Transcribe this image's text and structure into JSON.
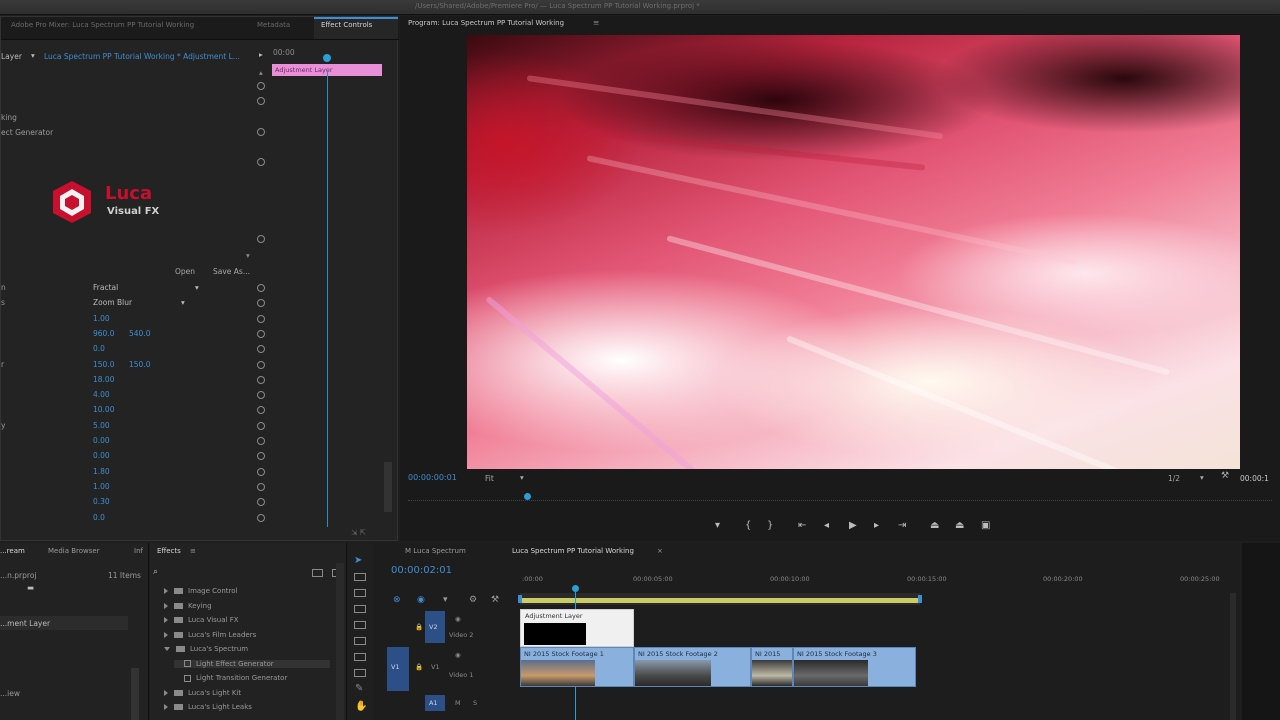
{
  "window": {
    "title": "/Users/Shared/Adobe/Premiere Pro/ — Luca Spectrum PP Tutorial Working.prproj *"
  },
  "effect_controls": {
    "tabs": [
      "Adobe Pro Mixer: Luca Spectrum PP Tutorial Working",
      "Metadata",
      "Effect Controls"
    ],
    "source_label": "Layer",
    "clip_path": "Luca Spectrum PP Tutorial Working * Adjustment L...",
    "time": "00:00",
    "clip_bar": "Adjustment Layer",
    "rows_left": [
      "king",
      "ect Generator"
    ],
    "logo": {
      "word": "Luca",
      "sub": "Visual FX"
    },
    "open_label": "Open",
    "save_label": "Save As...",
    "params": [
      {
        "label": "n",
        "value": "Fractal",
        "dropdown": true
      },
      {
        "label": "s",
        "value": "Zoom Blur",
        "dropdown": true
      },
      {
        "label": "",
        "value": "1.00"
      },
      {
        "label": "",
        "value": "960.0",
        "value2": "540.0"
      },
      {
        "label": "",
        "value": "0.0"
      },
      {
        "label": "r",
        "value": "150.0",
        "value2": "150.0"
      },
      {
        "label": "",
        "value": "18.00"
      },
      {
        "label": "",
        "value": "4.00"
      },
      {
        "label": "",
        "value": "10.00"
      },
      {
        "label": "y",
        "value": "5.00"
      },
      {
        "label": "",
        "value": "0.00"
      },
      {
        "label": "",
        "value": "0.00"
      },
      {
        "label": "",
        "value": "1.80"
      },
      {
        "label": "",
        "value": "1.00"
      },
      {
        "label": "",
        "value": "0.30"
      },
      {
        "label": "",
        "value": "0.0"
      }
    ]
  },
  "program_monitor": {
    "title": "Program: Luca Spectrum PP Tutorial Working",
    "timecode": "00:00:00:01",
    "fit": "Fit",
    "resolution": "1/2",
    "end_timecode": "00:00:1"
  },
  "project_panel": {
    "tabs": [
      "...ream",
      "Media Browser",
      "Inf"
    ],
    "path": "...n.prproj",
    "items_count": "11 Items",
    "item": "...ment Layer",
    "item2": "...iew"
  },
  "effects_panel": {
    "title": "Effects",
    "folders": [
      {
        "name": "Image Control",
        "open": false,
        "indent": 0
      },
      {
        "name": "Keying",
        "open": false,
        "indent": 0
      },
      {
        "name": "Luca Visual FX",
        "open": false,
        "indent": 0
      },
      {
        "name": "Luca's Film Leaders",
        "open": false,
        "indent": 0
      },
      {
        "name": "Luca's Spectrum",
        "open": true,
        "indent": 0
      },
      {
        "name": "Light Effect Generator",
        "open": false,
        "indent": 1
      },
      {
        "name": "Light Transition Generator",
        "open": false,
        "indent": 1
      },
      {
        "name": "Luca's Light Kit",
        "open": false,
        "indent": 0
      },
      {
        "name": "Luca's Light Leaks",
        "open": false,
        "indent": 0
      }
    ]
  },
  "sequence": {
    "tabs": [
      "M Luca Spectrum",
      "Luca Spectrum PP Tutorial Working"
    ],
    "timecode": "00:00:02:01",
    "ticks": [
      ":00:00",
      "00:00:05:00",
      "00:00:10:00",
      "00:00:15:00",
      "00:00:20:00",
      "00:00:25:00"
    ],
    "tracks": [
      {
        "id": "V2",
        "name": "Video 2"
      },
      {
        "id": "V1",
        "name": "Video 1"
      },
      {
        "id": "A1",
        "name": ""
      }
    ],
    "adjustment_clip": "Adjustment Layer",
    "clips": [
      "NI 2015 Stock Footage 1",
      "NI 2015 Stock Footage 2",
      "NI 2015",
      "NI 2015 Stock Footage 3"
    ]
  },
  "colors": {
    "accent": "#3f8ed1",
    "clip_pink": "#e98fd8",
    "clip_blue": "#8ab1de"
  }
}
